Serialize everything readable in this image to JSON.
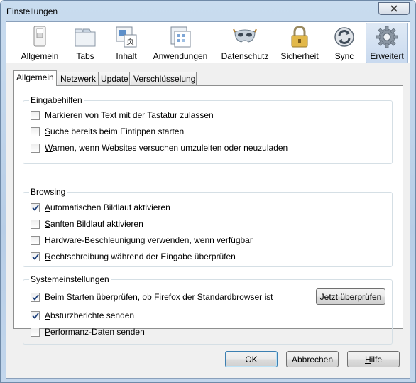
{
  "window": {
    "title": "Einstellungen"
  },
  "toolbar": {
    "items": [
      {
        "label": "Allgemein",
        "icon": "switch-icon"
      },
      {
        "label": "Tabs",
        "icon": "tabs-icon"
      },
      {
        "label": "Inhalt",
        "icon": "content-icon"
      },
      {
        "label": "Anwendungen",
        "icon": "applications-icon"
      },
      {
        "label": "Datenschutz",
        "icon": "privacy-mask-icon"
      },
      {
        "label": "Sicherheit",
        "icon": "padlock-icon"
      },
      {
        "label": "Sync",
        "icon": "sync-icon"
      },
      {
        "label": "Erweitert",
        "icon": "gear-icon",
        "selected": true
      }
    ]
  },
  "subtabs": [
    {
      "label": "Allgemein",
      "selected": true
    },
    {
      "label": "Netzwerk"
    },
    {
      "label": "Update"
    },
    {
      "label": "Verschlüsselung"
    }
  ],
  "groups": {
    "eingabehilfen": {
      "title": "Eingabehilfen",
      "items": [
        {
          "label": "Markieren von Text mit der Tastatur zulassen",
          "checked": false
        },
        {
          "label": "Suche bereits beim Eintippen starten",
          "checked": false
        },
        {
          "label": "Warnen, wenn Websites versuchen umzuleiten oder neuzuladen",
          "checked": false
        }
      ]
    },
    "browsing": {
      "title": "Browsing",
      "items": [
        {
          "label": "Automatischen Bildlauf aktivieren",
          "checked": true
        },
        {
          "label": "Sanften Bildlauf aktivieren",
          "checked": false
        },
        {
          "label": "Hardware-Beschleunigung verwenden, wenn verfügbar",
          "checked": false
        },
        {
          "label": "Rechtschreibung während der Eingabe überprüfen",
          "checked": true
        }
      ]
    },
    "system": {
      "title": "Systemeinstellungen",
      "items": [
        {
          "label": "Beim Starten überprüfen, ob Firefox der Standardbrowser ist",
          "checked": true
        },
        {
          "label": "Absturzberichte senden",
          "checked": true
        },
        {
          "label": "Performanz-Daten senden",
          "checked": false
        }
      ],
      "check_now_label": "Jetzt überprüfen"
    }
  },
  "footer": {
    "ok": "OK",
    "cancel": "Abbrechen",
    "help": "Hilfe"
  },
  "colors": {
    "window_frame": "#b7cde6",
    "selected_tab": "#c9daef",
    "check": "#1c3f7a"
  }
}
